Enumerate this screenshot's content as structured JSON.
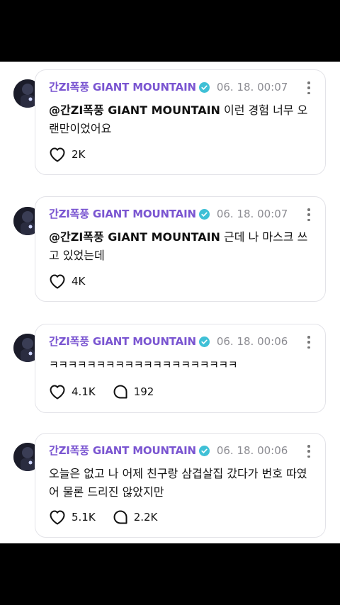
{
  "colors": {
    "author": "#7a55d1",
    "verified": "#3fc0d6",
    "timestamp": "#8c8c92",
    "border": "#e3e3e8"
  },
  "posts": [
    {
      "author": "간ZI폭풍 GIANT MOUNTAIN",
      "time": "06. 18. 00:07",
      "mention": "@간ZI폭풍 GIANT MOUNTAIN",
      "text": " 이런 경험 너무 오랜만이었어요",
      "likes": "2K",
      "comments": ""
    },
    {
      "author": "간ZI폭풍 GIANT MOUNTAIN",
      "time": "06. 18. 00:07",
      "mention": "@간ZI폭풍 GIANT MOUNTAIN",
      "text": " 근데 나 마스크 쓰고 있었는데",
      "likes": "4K",
      "comments": ""
    },
    {
      "author": "간ZI폭풍 GIANT MOUNTAIN",
      "time": "06. 18. 00:06",
      "mention": "",
      "text": "ㅋㅋㅋㅋㅋㅋㅋㅋㅋㅋㅋㅋㅋㅋㅋㅋㅋㅋㅋㅋ",
      "likes": "4.1K",
      "comments": "192"
    },
    {
      "author": "간ZI폭풍 GIANT MOUNTAIN",
      "time": "06. 18. 00:06",
      "mention": "",
      "text": "오늘은 없고 나 어제 친구랑 삼겹살집 갔다가 번호 따였어 물론 드리진 않았지만",
      "likes": "5.1K",
      "comments": "2.2K"
    }
  ]
}
